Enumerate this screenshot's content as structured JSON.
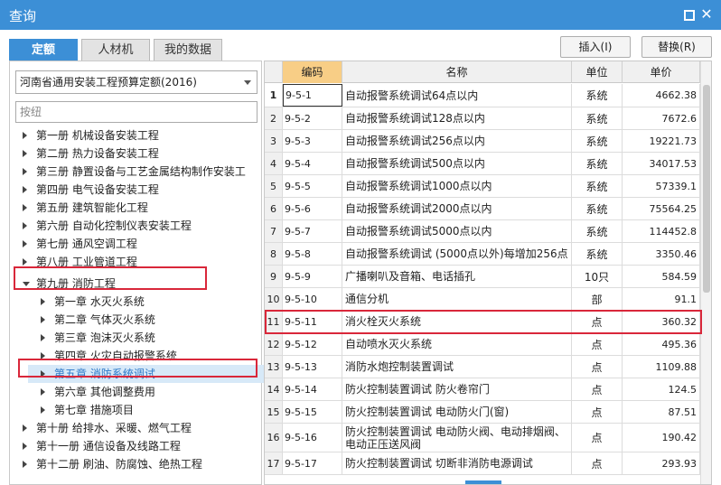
{
  "window": {
    "title": "查询"
  },
  "tabs": [
    {
      "label": "定额",
      "active": true
    },
    {
      "label": "人材机",
      "active": false
    },
    {
      "label": "我的数据",
      "active": false
    }
  ],
  "actions": {
    "insert": "插入(I)",
    "replace": "替换(R)"
  },
  "left": {
    "dropdown_value": "河南省通用安装工程预算定额(2016)",
    "search_placeholder": "按纽",
    "tree": [
      {
        "label": "第一册  机械设备安装工程",
        "level": 0,
        "expanded": false
      },
      {
        "label": "第二册  热力设备安装工程",
        "level": 0,
        "expanded": false
      },
      {
        "label": "第三册  静置设备与工艺金属结构制作安装工",
        "level": 0,
        "expanded": false
      },
      {
        "label": "第四册  电气设备安装工程",
        "level": 0,
        "expanded": false
      },
      {
        "label": "第五册  建筑智能化工程",
        "level": 0,
        "expanded": false
      },
      {
        "label": "第六册  自动化控制仪表安装工程",
        "level": 0,
        "expanded": false
      },
      {
        "label": "第七册  通风空调工程",
        "level": 0,
        "expanded": false
      },
      {
        "label": "第八册  工业管道工程",
        "level": 0,
        "expanded": false
      },
      {
        "label": "第九册  消防工程",
        "level": 0,
        "expanded": true
      },
      {
        "label": "第一章  水灭火系统",
        "level": 1,
        "expanded": false
      },
      {
        "label": "第二章  气体灭火系统",
        "level": 1,
        "expanded": false
      },
      {
        "label": "第三章  泡沫灭火系统",
        "level": 1,
        "expanded": false
      },
      {
        "label": "第四章  火灾自动报警系统",
        "level": 1,
        "expanded": false
      },
      {
        "label": "第五章  消防系统调试",
        "level": 1,
        "expanded": false,
        "selected": true
      },
      {
        "label": "第六章  其他调整费用",
        "level": 1,
        "expanded": false
      },
      {
        "label": "第七章  措施项目",
        "level": 1,
        "expanded": false
      },
      {
        "label": "第十册  给排水、采暖、燃气工程",
        "level": 0,
        "expanded": false
      },
      {
        "label": "第十一册  通信设备及线路工程",
        "level": 0,
        "expanded": false
      },
      {
        "label": "第十二册  刷油、防腐蚀、绝热工程",
        "level": 0,
        "expanded": false
      }
    ]
  },
  "grid": {
    "columns": {
      "code": "编码",
      "name": "名称",
      "unit": "单位",
      "price": "单价"
    },
    "rows": [
      {
        "idx": "1",
        "code": "9-5-1",
        "name": "自动报警系统调试64点以内",
        "unit": "系统",
        "price": "4662.38"
      },
      {
        "idx": "2",
        "code": "9-5-2",
        "name": "自动报警系统调试128点以内",
        "unit": "系统",
        "price": "7672.6"
      },
      {
        "idx": "3",
        "code": "9-5-3",
        "name": "自动报警系统调试256点以内",
        "unit": "系统",
        "price": "19221.73"
      },
      {
        "idx": "4",
        "code": "9-5-4",
        "name": "自动报警系统调试500点以内",
        "unit": "系统",
        "price": "34017.53"
      },
      {
        "idx": "5",
        "code": "9-5-5",
        "name": "自动报警系统调试1000点以内",
        "unit": "系统",
        "price": "57339.1"
      },
      {
        "idx": "6",
        "code": "9-5-6",
        "name": "自动报警系统调试2000点以内",
        "unit": "系统",
        "price": "75564.25"
      },
      {
        "idx": "7",
        "code": "9-5-7",
        "name": "自动报警系统调试5000点以内",
        "unit": "系统",
        "price": "114452.8"
      },
      {
        "idx": "8",
        "code": "9-5-8",
        "name": "自动报警系统调试 (5000点以外)每增加256点",
        "unit": "系统",
        "price": "3350.46"
      },
      {
        "idx": "9",
        "code": "9-5-9",
        "name": "广播喇叭及音箱、电话插孔",
        "unit": "10只",
        "price": "584.59"
      },
      {
        "idx": "10",
        "code": "9-5-10",
        "name": "通信分机",
        "unit": "部",
        "price": "91.1"
      },
      {
        "idx": "11",
        "code": "9-5-11",
        "name": "消火栓灭火系统",
        "unit": "点",
        "price": "360.32"
      },
      {
        "idx": "12",
        "code": "9-5-12",
        "name": "自动喷水灭火系统",
        "unit": "点",
        "price": "495.36"
      },
      {
        "idx": "13",
        "code": "9-5-13",
        "name": "消防水炮控制装置调试",
        "unit": "点",
        "price": "1109.88"
      },
      {
        "idx": "14",
        "code": "9-5-14",
        "name": "防火控制装置调试 防火卷帘门",
        "unit": "点",
        "price": "124.5"
      },
      {
        "idx": "15",
        "code": "9-5-15",
        "name": "防火控制装置调试 电动防火门(窗)",
        "unit": "点",
        "price": "87.51"
      },
      {
        "idx": "16",
        "code": "9-5-16",
        "name": "防火控制装置调试 电动防火阀、电动排烟阀、电动正压送风阀",
        "unit": "点",
        "price": "190.42"
      },
      {
        "idx": "17",
        "code": "9-5-17",
        "name": "防火控制装置调试 切断非消防电源调试",
        "unit": "点",
        "price": "293.93"
      }
    ]
  },
  "colors": {
    "accent": "#3c8fd6",
    "highlight": "#d9273a",
    "code_header": "#f8ce86"
  }
}
